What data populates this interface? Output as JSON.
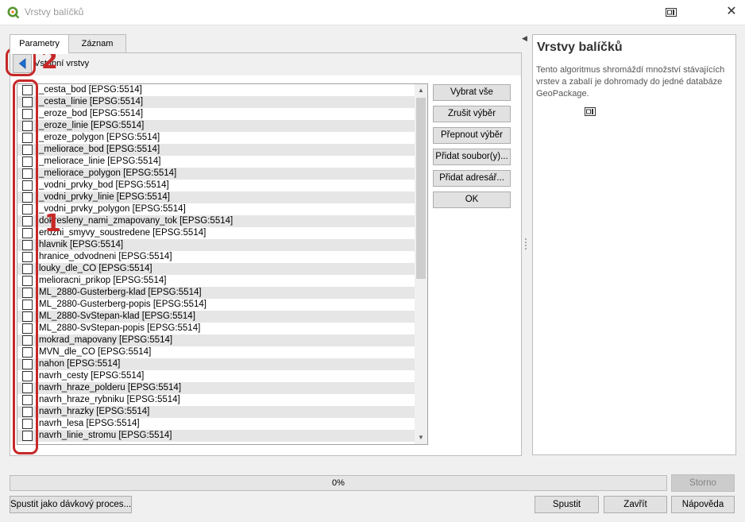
{
  "window": {
    "title": "Vrstvy balíčků",
    "close_glyph": "✕",
    "icons": {
      "app": "qgis-logo-icon",
      "context_help": "context-help-icon",
      "close": "close-icon"
    }
  },
  "tabs": [
    {
      "label": "Parametry",
      "active": true
    },
    {
      "label": "Záznam",
      "active": false
    }
  ],
  "input_group": {
    "label": "Vstupní vrstvy",
    "back_icon": "back-arrow-icon"
  },
  "layers": [
    "_cesta_bod [EPSG:5514]",
    "_cesta_linie [EPSG:5514]",
    "_eroze_bod [EPSG:5514]",
    "_eroze_linie [EPSG:5514]",
    "_eroze_polygon [EPSG:5514]",
    "_meliorace_bod [EPSG:5514]",
    "_meliorace_linie [EPSG:5514]",
    "_meliorace_polygon [EPSG:5514]",
    "_vodni_prvky_bod [EPSG:5514]",
    "_vodni_prvky_linie [EPSG:5514]",
    "_vodni_prvky_polygon [EPSG:5514]",
    "dokresleny_nami_zmapovany_tok [EPSG:5514]",
    "erozni_smyvy_soustredene [EPSG:5514]",
    "hlavnik [EPSG:5514]",
    "hranice_odvodneni [EPSG:5514]",
    "louky_dle_CO [EPSG:5514]",
    "melioracni_prikop [EPSG:5514]",
    "ML_2880-Gusterberg-klad [EPSG:5514]",
    "ML_2880-Gusterberg-popis [EPSG:5514]",
    "ML_2880-SvStepan-klad [EPSG:5514]",
    "ML_2880-SvStepan-popis [EPSG:5514]",
    "mokrad_mapovany [EPSG:5514]",
    "MVN_dle_CO [EPSG:5514]",
    "nahon [EPSG:5514]",
    "navrh_cesty [EPSG:5514]",
    "navrh_hraze_polderu [EPSG:5514]",
    "navrh_hraze_rybniku [EPSG:5514]",
    "navrh_hrazky [EPSG:5514]",
    "navrh_lesa [EPSG:5514]",
    "navrh_linie_stromu [EPSG:5514]"
  ],
  "side_buttons": {
    "select_all": "Vybrat vše",
    "clear": "Zrušit výběr",
    "toggle": "Přepnout výběr",
    "add_files": "Přidat soubor(y)...",
    "add_dir": "Přidat adresář...",
    "ok": "OK"
  },
  "help_panel": {
    "title": "Vrstvy balíčků",
    "description": "Tento algoritmus shromáždí množství stávajících vrstev a zabalí je dohromady do jedné databáze GeoPackage."
  },
  "progress": {
    "text": "0%",
    "value": 0
  },
  "bottom": {
    "cancel": "Storno",
    "batch": "Spustit jako dávkový proces...",
    "run": "Spustit",
    "close": "Zavřít",
    "help": "Nápověda"
  },
  "annotations": {
    "one": "1",
    "two": "2"
  },
  "colors": {
    "annotation": "#c62828",
    "back_arrow": "#1e6fd1"
  }
}
